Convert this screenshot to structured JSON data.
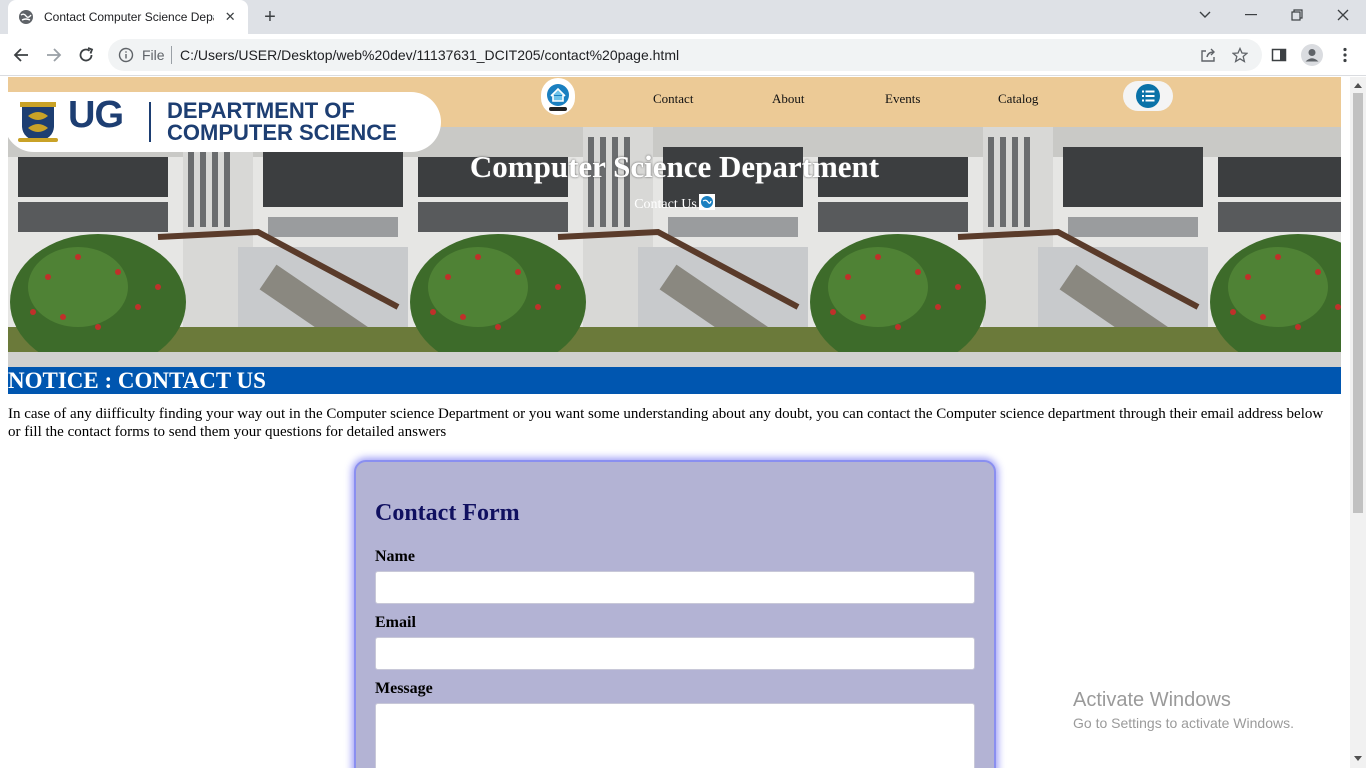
{
  "browser": {
    "tab_title": "Contact Computer Science Depa",
    "omnibox_scheme": "File",
    "url": "C:/Users/USER/Desktop/web%20dev/11137631_DCIT205/contact%20page.html",
    "icons": [
      "globe-favicon-icon",
      "close-icon",
      "plus-icon",
      "chevron-down-icon",
      "minimize-icon",
      "restore-icon",
      "close-window-icon",
      "back-arrow-icon",
      "forward-arrow-icon",
      "reload-icon",
      "info-icon",
      "share-icon",
      "star-icon",
      "side-panel-icon",
      "profile-icon",
      "kebab-menu-icon"
    ]
  },
  "colors": {
    "navbar": "#ecca96",
    "notice_bar": "#0056b0",
    "form_card": "#b3b3d4",
    "logo_text": "#1d3e72"
  },
  "site": {
    "logo": {
      "ug": "UG",
      "dept_line1": "DEPARTMENT OF",
      "dept_line2": "COMPUTER SCIENCE"
    },
    "nav": {
      "links": [
        "Contact",
        "About",
        "Events",
        "Catalog"
      ]
    },
    "hero": {
      "title": "Computer Science Department",
      "subtitle": "Contact Us"
    },
    "notice": {
      "heading": "NOTICE : CONTACT US"
    },
    "intro": "In case of any diifficulty finding your way out in the Computer science Department or you want some understanding about any doubt, you can contact the Computer science department through their email address below or fill the contact forms to send them your questions for detailed answers",
    "form": {
      "title": "Contact Form",
      "name_label": "Name",
      "name_value": "",
      "email_label": "Email",
      "email_value": "",
      "message_label": "Message",
      "message_value": ""
    }
  },
  "watermark": {
    "title": "Activate Windows",
    "subtitle": "Go to Settings to activate Windows."
  }
}
